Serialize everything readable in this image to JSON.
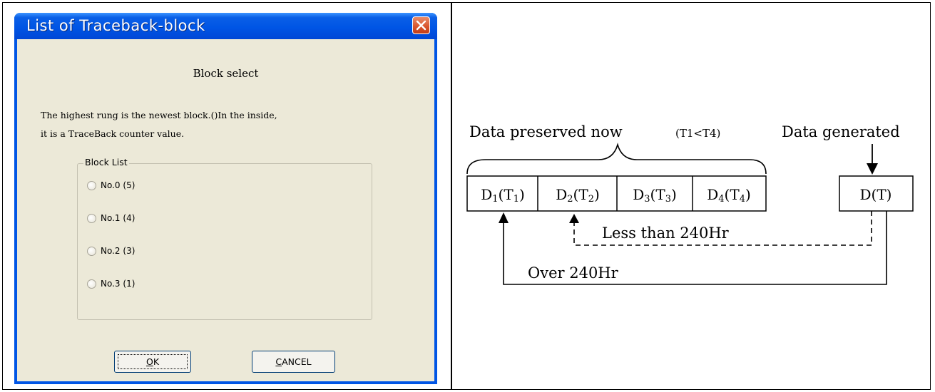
{
  "dialog": {
    "title": "List of Traceback-block",
    "heading": "Block select",
    "description": "The highest rung is the newest block.()In the inside,\nit is a TraceBack counter value.",
    "group_label": "Block List",
    "options": [
      {
        "no": "No.0",
        "count": "(5)"
      },
      {
        "no": "No.1",
        "count": "(4)"
      },
      {
        "no": "No.2",
        "count": "(3)"
      },
      {
        "no": "No.3",
        "count": "(1)"
      }
    ],
    "ok": {
      "rest": "K",
      "mnemonic": "O"
    },
    "cancel": {
      "mnemonic": "C",
      "rest": "ANCEL"
    }
  },
  "diagram": {
    "preserved_label": "Data preserved now",
    "preserved_condition": "(T1<T4)",
    "generated_label": "Data generated",
    "cells": [
      {
        "d": "D",
        "sub": "1",
        "t": "T",
        "tsub": "1"
      },
      {
        "d": "D",
        "sub": "2",
        "t": "T",
        "tsub": "2"
      },
      {
        "d": "D",
        "sub": "3",
        "t": "T",
        "tsub": "3"
      },
      {
        "d": "D",
        "sub": "4",
        "t": "T",
        "tsub": "4"
      }
    ],
    "new_cell": "D(T)",
    "less_label": "Less than 240Hr",
    "over_label": "Over 240Hr"
  }
}
